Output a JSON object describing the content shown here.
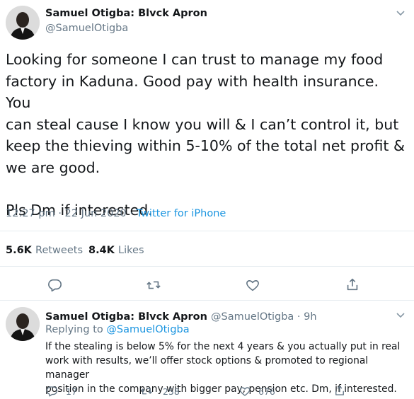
{
  "tweet": {
    "author_name": "Samuel Otigba: Blvck Apron",
    "author_handle": "@SamuelOtigba",
    "text_lines": [
      "Looking for someone I can trust to manage my food",
      "factory in Kaduna. Good pay with health insurance. You",
      "can steal cause I know you will & I can’t control it, but",
      "keep the thieving within 5-10% of the total net profit &",
      "we are good.",
      "",
      "Pls Dm if interested."
    ],
    "time": "12:27 pm · 22 Jun 2020 · ",
    "source": "Twitter for iPhone",
    "retweets_count": "5.6K",
    "retweets_label": "Retweets",
    "likes_count": "8.4K",
    "likes_label": "Likes"
  },
  "reply": {
    "author_name": "Samuel Otigba: Blvck Apron",
    "author_handle": "@SamuelOtigba · 9h",
    "replying_prefix": "Replying to ",
    "replying_to": "@SamuelOtigba",
    "text_lines": [
      "If the stealing is below 5% for the next 4 years & you actually put in real",
      "work with results, we’ll offer stock options & promoted to regional manager",
      "position in the company with bigger pay, pension etc. Dm, if interested."
    ],
    "reply_count": "17",
    "retweet_count": "258",
    "like_count": "676"
  },
  "icons": [
    "chevron-down-icon",
    "reply-icon",
    "retweet-icon",
    "like-icon",
    "share-icon"
  ],
  "colors": {
    "link": "#1b95e0",
    "muted": "#657786",
    "text": "#14171a",
    "divider": "#e6ecf0"
  }
}
